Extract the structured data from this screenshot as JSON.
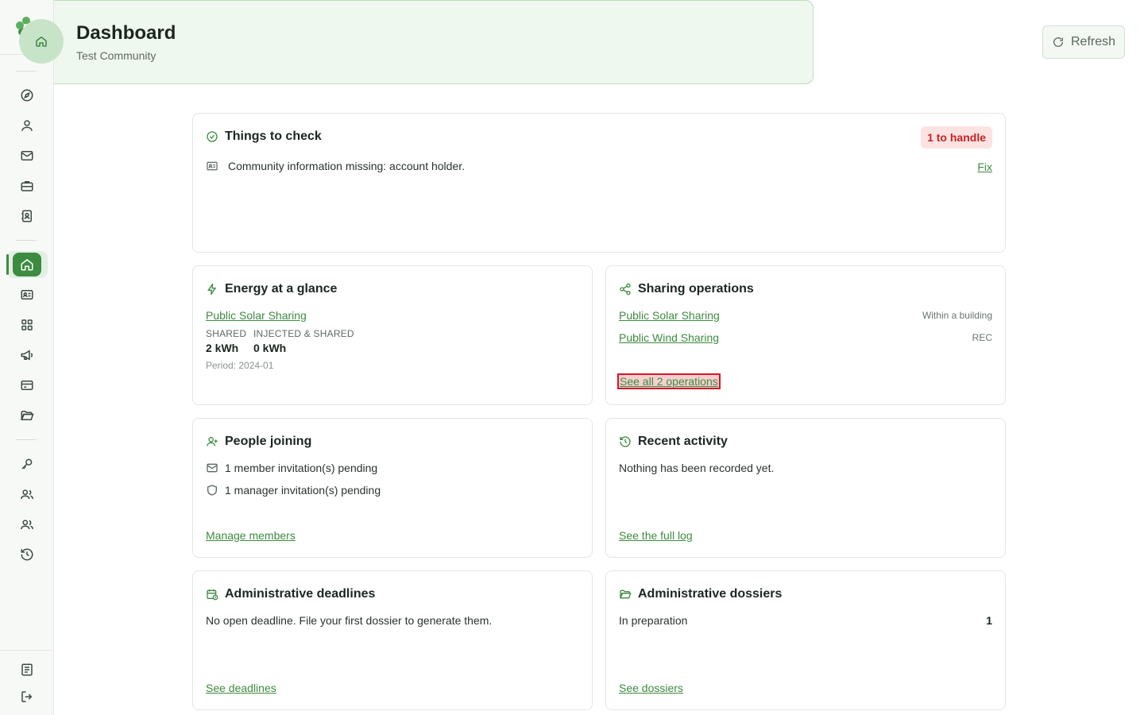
{
  "header": {
    "title": "Dashboard",
    "subtitle": "Test Community",
    "refresh_label": "Refresh",
    "home_icon": "home-icon"
  },
  "colors": {
    "brand": "#3d8b40",
    "header_bg": "#eff8ef",
    "badge_bg": "#fde2e2",
    "badge_text": "#c42424"
  },
  "sidebar": {
    "top_items": [
      "compass-icon",
      "user-icon",
      "mail-icon",
      "briefcase-icon",
      "contact-book-icon"
    ],
    "middle_items": [
      "home-icon",
      "id-card-icon",
      "grid-icon",
      "megaphone-icon",
      "credit-card-icon",
      "folder-open-icon"
    ],
    "lower_items": [
      "key-icon",
      "users-icon",
      "users-alt-icon",
      "history-icon"
    ],
    "bottom_items": [
      "document-icon",
      "logout-icon"
    ],
    "active_item": "home-icon"
  },
  "things_to_check": {
    "title": "Things to check",
    "badge": "1 to handle",
    "items": [
      {
        "text": "Community information missing: account holder.",
        "action": "Fix"
      }
    ]
  },
  "energy": {
    "title": "Energy at a glance",
    "operation_link": "Public Solar Sharing",
    "shared_label": "SHARED",
    "shared_value": "2 kWh",
    "injected_label": "INJECTED & SHARED",
    "injected_value": "0 kWh",
    "period": "Period: 2024-01"
  },
  "sharing": {
    "title": "Sharing operations",
    "operations": [
      {
        "name": "Public Solar Sharing",
        "type": "Within a building"
      },
      {
        "name": "Public Wind Sharing",
        "type": "REC"
      }
    ],
    "see_all": "See all 2 operations"
  },
  "people": {
    "title": "People joining",
    "member_invites": "1 member invitation(s) pending",
    "manager_invites": "1 manager invitation(s) pending",
    "link": "Manage members"
  },
  "activity": {
    "title": "Recent activity",
    "empty": "Nothing has been recorded yet.",
    "link": "See the full log"
  },
  "deadlines": {
    "title": "Administrative deadlines",
    "empty": "No open deadline. File your first dossier to generate them.",
    "link": "See deadlines"
  },
  "dossiers": {
    "title": "Administrative dossiers",
    "row_label": "In preparation",
    "row_count": "1",
    "link": "See dossiers"
  }
}
